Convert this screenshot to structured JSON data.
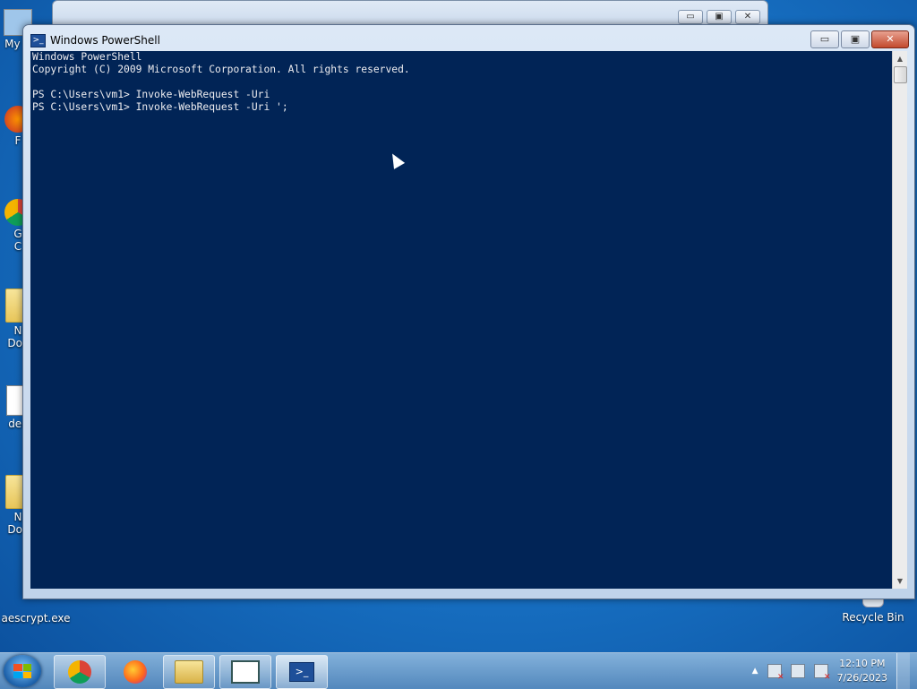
{
  "desktop": {
    "icons": [
      {
        "label": "My C"
      },
      {
        "label": "F"
      },
      {
        "label": "G"
      },
      {
        "label": "C"
      },
      {
        "label": "N"
      },
      {
        "label": "Doc"
      },
      {
        "label": "dec"
      },
      {
        "label": "N"
      },
      {
        "label": "Doc"
      },
      {
        "label": "aescrypt.exe"
      },
      {
        "label": "Recycle Bin"
      }
    ]
  },
  "background_window": {
    "min": "▭",
    "max": "▣",
    "close": "✕"
  },
  "powershell": {
    "title": "Windows PowerShell",
    "controls": {
      "min": "▭",
      "max": "▣",
      "close": "✕"
    },
    "console_lines": [
      "Windows PowerShell",
      "Copyright (C) 2009 Microsoft Corporation. All rights reserved.",
      "",
      "PS C:\\Users\\vm1> Invoke-WebRequest -Uri",
      "PS C:\\Users\\vm1> Invoke-WebRequest -Uri ';"
    ],
    "scroll": {
      "up": "▲",
      "down": "▼"
    }
  },
  "taskbar": {
    "pinned": [
      "chrome-icon",
      "firefox-icon",
      "explorer-icon",
      "notepad-icon",
      "powershell-icon"
    ],
    "clock": {
      "time": "12:10 PM",
      "date": "7/26/2023"
    },
    "tray_arrow": "▲"
  }
}
